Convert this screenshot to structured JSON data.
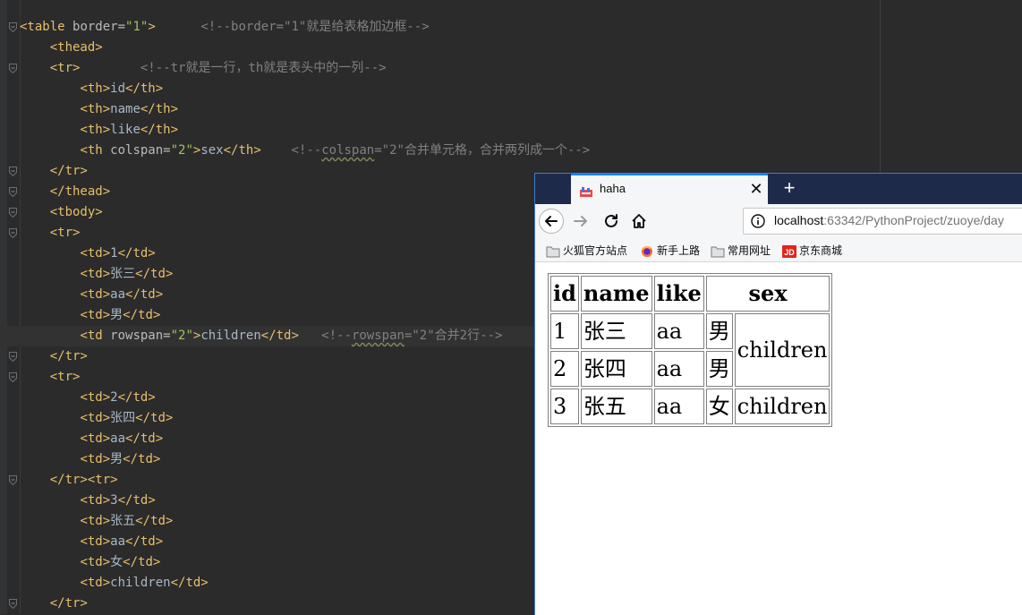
{
  "editor": {
    "lines": [
      {
        "fold": true,
        "segs": [
          [
            "t",
            "<table "
          ],
          [
            "a",
            "border="
          ],
          [
            "s",
            "\"1\""
          ],
          [
            "t",
            ">"
          ],
          [
            "w",
            "      "
          ],
          [
            "c",
            "<!--border=\"1\"就是给表格加边框-->"
          ]
        ]
      },
      {
        "fold": false,
        "segs": [
          [
            "w",
            "    "
          ],
          [
            "t",
            "<thead>"
          ]
        ]
      },
      {
        "fold": true,
        "segs": [
          [
            "w",
            "    "
          ],
          [
            "t",
            "<tr>"
          ],
          [
            "w",
            "        "
          ],
          [
            "c",
            "<!--tr就是一行，th就是表头中的一列-->"
          ]
        ]
      },
      {
        "fold": false,
        "segs": [
          [
            "w",
            "        "
          ],
          [
            "t",
            "<th>"
          ],
          [
            "x",
            "id"
          ],
          [
            "t",
            "</th>"
          ]
        ]
      },
      {
        "fold": false,
        "segs": [
          [
            "w",
            "        "
          ],
          [
            "t",
            "<th>"
          ],
          [
            "x",
            "name"
          ],
          [
            "t",
            "</th>"
          ]
        ]
      },
      {
        "fold": false,
        "segs": [
          [
            "w",
            "        "
          ],
          [
            "t",
            "<th>"
          ],
          [
            "x",
            "like"
          ],
          [
            "t",
            "</th>"
          ]
        ]
      },
      {
        "fold": false,
        "segs": [
          [
            "w",
            "        "
          ],
          [
            "t",
            "<th "
          ],
          [
            "a",
            "colspan="
          ],
          [
            "s",
            "\"2\""
          ],
          [
            "t",
            ">"
          ],
          [
            "x",
            "sex"
          ],
          [
            "t",
            "</th>"
          ],
          [
            "w",
            "    "
          ],
          [
            "c",
            "<!--"
          ],
          [
            "cu",
            "colspan"
          ],
          [
            "c",
            "=\"2\"合并单元格，合并两列成一个-->"
          ]
        ]
      },
      {
        "fold": true,
        "segs": [
          [
            "w",
            "    "
          ],
          [
            "t",
            "</tr>"
          ]
        ]
      },
      {
        "fold": true,
        "segs": [
          [
            "w",
            "    "
          ],
          [
            "t",
            "</thead>"
          ]
        ]
      },
      {
        "fold": true,
        "segs": [
          [
            "w",
            "    "
          ],
          [
            "t",
            "<tbody>"
          ]
        ]
      },
      {
        "fold": true,
        "segs": [
          [
            "w",
            "    "
          ],
          [
            "t",
            "<tr>"
          ]
        ]
      },
      {
        "fold": false,
        "segs": [
          [
            "w",
            "        "
          ],
          [
            "t",
            "<td>"
          ],
          [
            "x",
            "1"
          ],
          [
            "t",
            "</td>"
          ]
        ]
      },
      {
        "fold": false,
        "segs": [
          [
            "w",
            "        "
          ],
          [
            "t",
            "<td>"
          ],
          [
            "x",
            "张三"
          ],
          [
            "t",
            "</td>"
          ]
        ]
      },
      {
        "fold": false,
        "segs": [
          [
            "w",
            "        "
          ],
          [
            "t",
            "<td>"
          ],
          [
            "x",
            "aa"
          ],
          [
            "t",
            "</td>"
          ]
        ]
      },
      {
        "fold": false,
        "segs": [
          [
            "w",
            "        "
          ],
          [
            "t",
            "<td>"
          ],
          [
            "x",
            "男"
          ],
          [
            "t",
            "</td>"
          ]
        ]
      },
      {
        "fold": false,
        "current": true,
        "segs": [
          [
            "w",
            "        "
          ],
          [
            "t",
            "<td "
          ],
          [
            "a",
            "rowspan="
          ],
          [
            "s",
            "\"2\""
          ],
          [
            "t",
            ">"
          ],
          [
            "x",
            "children"
          ],
          [
            "t",
            "</td>"
          ],
          [
            "w",
            "   "
          ],
          [
            "c",
            "<!--"
          ],
          [
            "cu",
            "rowspan"
          ],
          [
            "c",
            "=\"2\"合并2行-->"
          ]
        ]
      },
      {
        "fold": true,
        "segs": [
          [
            "w",
            "    "
          ],
          [
            "t",
            "</tr>"
          ]
        ]
      },
      {
        "fold": true,
        "segs": [
          [
            "w",
            "    "
          ],
          [
            "t",
            "<tr>"
          ]
        ]
      },
      {
        "fold": false,
        "segs": [
          [
            "w",
            "        "
          ],
          [
            "t",
            "<td>"
          ],
          [
            "x",
            "2"
          ],
          [
            "t",
            "</td>"
          ]
        ]
      },
      {
        "fold": false,
        "segs": [
          [
            "w",
            "        "
          ],
          [
            "t",
            "<td>"
          ],
          [
            "x",
            "张四"
          ],
          [
            "t",
            "</td>"
          ]
        ]
      },
      {
        "fold": false,
        "segs": [
          [
            "w",
            "        "
          ],
          [
            "t",
            "<td>"
          ],
          [
            "x",
            "aa"
          ],
          [
            "t",
            "</td>"
          ]
        ]
      },
      {
        "fold": false,
        "segs": [
          [
            "w",
            "        "
          ],
          [
            "t",
            "<td>"
          ],
          [
            "x",
            "男"
          ],
          [
            "t",
            "</td>"
          ]
        ]
      },
      {
        "fold": true,
        "segs": [
          [
            "w",
            "    "
          ],
          [
            "t",
            "</tr><tr>"
          ]
        ]
      },
      {
        "fold": false,
        "segs": [
          [
            "w",
            "        "
          ],
          [
            "t",
            "<td>"
          ],
          [
            "x",
            "3"
          ],
          [
            "t",
            "</td>"
          ]
        ]
      },
      {
        "fold": false,
        "segs": [
          [
            "w",
            "        "
          ],
          [
            "t",
            "<td>"
          ],
          [
            "x",
            "张五"
          ],
          [
            "t",
            "</td>"
          ]
        ]
      },
      {
        "fold": false,
        "segs": [
          [
            "w",
            "        "
          ],
          [
            "t",
            "<td>"
          ],
          [
            "x",
            "aa"
          ],
          [
            "t",
            "</td>"
          ]
        ]
      },
      {
        "fold": false,
        "segs": [
          [
            "w",
            "        "
          ],
          [
            "t",
            "<td>"
          ],
          [
            "x",
            "女"
          ],
          [
            "t",
            "</td>"
          ]
        ]
      },
      {
        "fold": false,
        "segs": [
          [
            "w",
            "        "
          ],
          [
            "t",
            "<td>"
          ],
          [
            "x",
            "children"
          ],
          [
            "t",
            "</td>"
          ]
        ]
      },
      {
        "fold": true,
        "segs": [
          [
            "w",
            "    "
          ],
          [
            "t",
            "</tr>"
          ]
        ]
      }
    ]
  },
  "browser": {
    "tab": {
      "title": "haha",
      "close": "✕",
      "favicon": "page-favicon"
    },
    "new_tab": "+",
    "url": {
      "host": "localhost",
      "rest": ":63342/PythonProject/zuoye/day"
    },
    "bookmarks": [
      {
        "label": "火狐官方站点",
        "icon": "folder-icon"
      },
      {
        "label": "新手上路",
        "icon": "firefox-icon"
      },
      {
        "label": "常用网址",
        "icon": "folder-icon"
      },
      {
        "label": "京东商城",
        "icon": "jd-icon"
      }
    ],
    "table": {
      "headers": [
        "id",
        "name",
        "like",
        "sex"
      ],
      "rows": [
        [
          "1",
          "张三",
          "aa",
          "男",
          "children"
        ],
        [
          "2",
          "张四",
          "aa",
          "男"
        ],
        [
          "3",
          "张五",
          "aa",
          "女",
          "children"
        ]
      ]
    }
  },
  "colors": {
    "editor_bg": "#2b2b2b",
    "tag": "#e8bf6a",
    "attr": "#bababa",
    "string": "#a5c25c",
    "comment": "#808080",
    "text": "#a9b7c6",
    "tabbar": "#1e2a4a",
    "accent": "#0a84ff"
  }
}
